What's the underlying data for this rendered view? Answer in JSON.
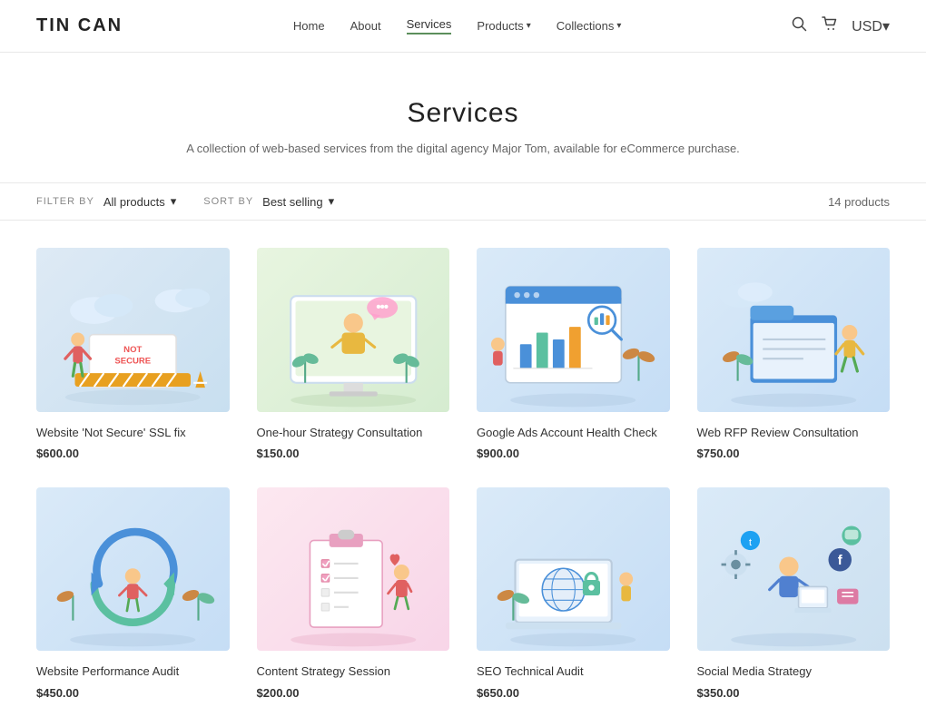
{
  "header": {
    "logo": "TIN CAN",
    "nav": [
      {
        "label": "Home",
        "active": false
      },
      {
        "label": "About",
        "active": false
      },
      {
        "label": "Services",
        "active": true
      },
      {
        "label": "Products",
        "dropdown": true,
        "active": false
      },
      {
        "label": "Collections",
        "dropdown": true,
        "active": false
      }
    ],
    "icons": {
      "search": "🔍",
      "cart": "🛒"
    },
    "currency": "USD▾"
  },
  "page": {
    "title": "Services",
    "subtitle": "A collection of web-based services from the digital agency Major Tom, available for eCommerce purchase."
  },
  "filter": {
    "filter_by_label": "FILTER BY",
    "filter_value": "All products",
    "sort_by_label": "SORT BY",
    "sort_value": "Best selling",
    "product_count": "14 products"
  },
  "products": [
    {
      "id": 1,
      "title": "Website 'Not Secure' SSL fix",
      "price": "$600.00",
      "bg_class": "card1-bg"
    },
    {
      "id": 2,
      "title": "One-hour Strategy Consultation",
      "price": "$150.00",
      "bg_class": "card2-bg"
    },
    {
      "id": 3,
      "title": "Google Ads Account Health Check",
      "price": "$900.00",
      "bg_class": "card3-bg"
    },
    {
      "id": 4,
      "title": "Web RFP Review Consultation",
      "price": "$750.00",
      "bg_class": "card4-bg"
    },
    {
      "id": 5,
      "title": "Website Performance Audit",
      "price": "$450.00",
      "bg_class": "card5-bg"
    },
    {
      "id": 6,
      "title": "Content Strategy Session",
      "price": "$200.00",
      "bg_class": "card6-bg"
    },
    {
      "id": 7,
      "title": "SEO Technical Audit",
      "price": "$650.00",
      "bg_class": "card7-bg"
    },
    {
      "id": 8,
      "title": "Social Media Strategy",
      "price": "$350.00",
      "bg_class": "card8-bg"
    }
  ]
}
